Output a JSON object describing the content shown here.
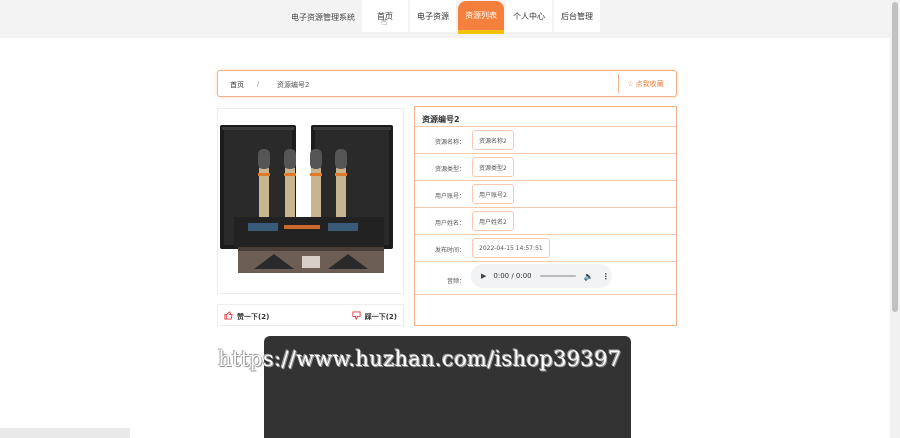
{
  "header": {
    "site_name": "电子资源管理系统",
    "nav": [
      {
        "label": "首页",
        "active": false
      },
      {
        "label": "电子资源",
        "active": false
      },
      {
        "label": "资源列表",
        "active": true
      },
      {
        "label": "个人中心",
        "active": false
      },
      {
        "label": "后台管理",
        "active": false
      }
    ]
  },
  "breadcrumb": {
    "home": "首页",
    "separator": "/",
    "current": "资源编号2",
    "favorite_label": "点我收藏"
  },
  "votes": {
    "up_label": "赞一下(2)",
    "down_label": "踩一下(2)"
  },
  "detail": {
    "title": "资源编号2",
    "fields": [
      {
        "label": "资源名称：",
        "value": "资源名称2"
      },
      {
        "label": "资源类型：",
        "value": "资源类型2"
      },
      {
        "label": "用户账号：",
        "value": "用户账号2"
      },
      {
        "label": "用户姓名：",
        "value": "用户姓名2"
      },
      {
        "label": "发布时间：",
        "value": "2022-04-15 14:57:51"
      }
    ],
    "audio_label": "音频：",
    "audio_time": "0:00 / 0:00"
  },
  "watermark": "https://www.huzhan.com/ishop39397",
  "colors": {
    "accent": "#f5803e",
    "accent_border": "#f4b08a",
    "underline": "#f2c200"
  }
}
